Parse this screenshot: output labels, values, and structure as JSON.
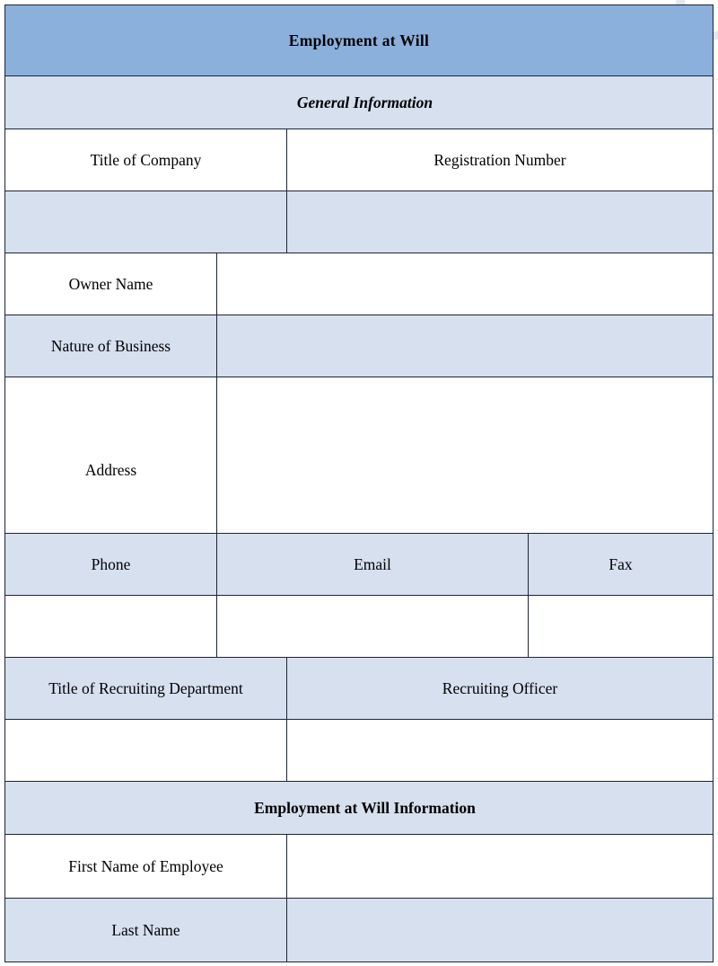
{
  "document": {
    "title": "Employment at Will",
    "watermark": "editableforms.com"
  },
  "colors": {
    "header_blue": "#8cb0dc",
    "row_blue": "#d7e0ef",
    "row_white": "#ffffff",
    "border": "#1d2436",
    "watermark": "#e3e7ee"
  },
  "sections": [
    {
      "id": "general",
      "heading": "General Information",
      "style": "italic"
    },
    {
      "id": "eaw",
      "heading": "Employment at Will Information",
      "style": "plain"
    }
  ],
  "fields": {
    "title_of_company": "Title of Company",
    "registration_number": "Registration Number",
    "owner_name": "Owner Name",
    "nature_of_business": "Nature of Business",
    "address": "Address",
    "phone": "Phone",
    "email": "Email",
    "fax": "Fax",
    "title_of_recruiting_department": "Title of Recruiting Department",
    "recruiting_officer": "Recruiting Officer",
    "first_name_of_employee": "First Name of Employee",
    "last_name": "Last Name"
  },
  "values": {
    "title_of_company": "",
    "registration_number": "",
    "owner_name": "",
    "nature_of_business": "",
    "address": "",
    "phone": "",
    "email": "",
    "fax": "",
    "title_of_recruiting_department": "",
    "recruiting_officer": "",
    "first_name_of_employee": "",
    "last_name": ""
  }
}
